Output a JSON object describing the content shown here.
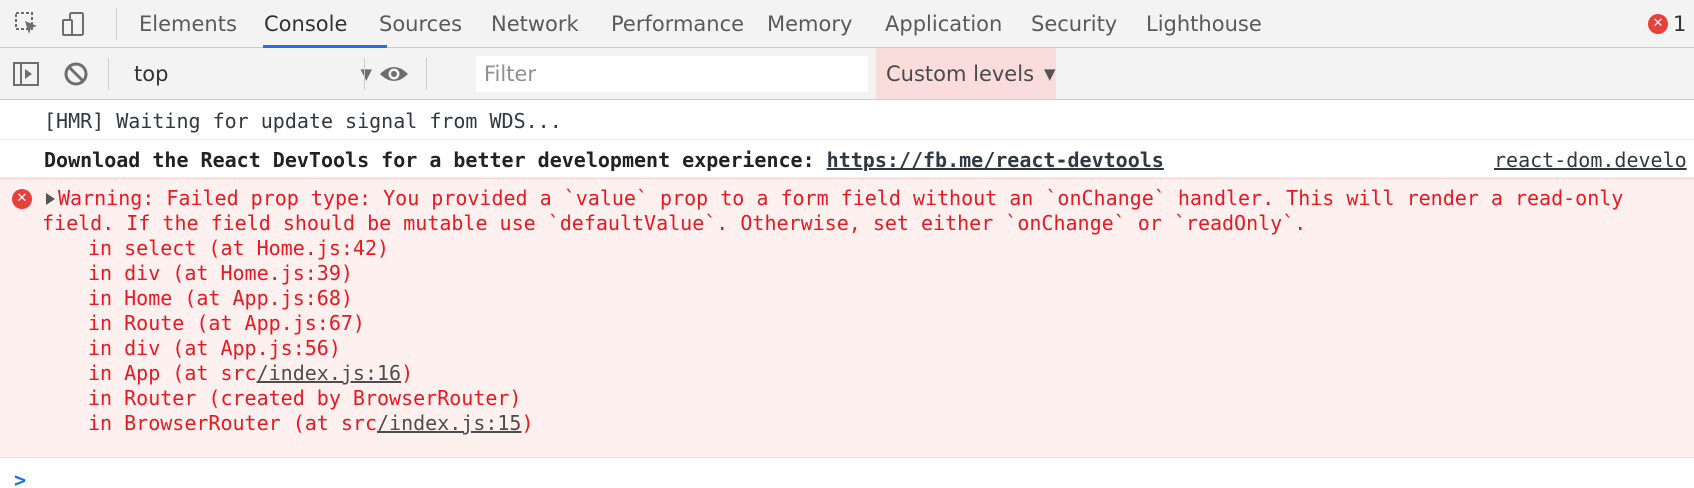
{
  "tabs": [
    {
      "label": "Elements"
    },
    {
      "label": "Console"
    },
    {
      "label": "Sources"
    },
    {
      "label": "Network"
    },
    {
      "label": "Performance"
    },
    {
      "label": "Memory"
    },
    {
      "label": "Application"
    },
    {
      "label": "Security"
    },
    {
      "label": "Lighthouse"
    }
  ],
  "active_tab": "Console",
  "error_count": "1",
  "toolbar": {
    "context": "top",
    "filter_placeholder": "Filter",
    "levels_label": "Custom levels"
  },
  "console": {
    "messages": [
      {
        "text": "[HMR] Waiting for update signal from WDS..."
      },
      {
        "text": "Download the React DevTools for a better development experience: ",
        "link": "https://fb.me/react-devtools",
        "source": "react-dom.develo"
      }
    ],
    "warning": {
      "line1": "Warning: Failed prop type: You provided a `value` prop to a form field without an `onChange` handler. This will render a read-only",
      "line2": "field. If the field should be mutable use `defaultValue`. Otherwise, set either `onChange` or `readOnly`.",
      "stack": [
        {
          "text": "in select (at Home.js:42)"
        },
        {
          "text": "in div (at Home.js:39)"
        },
        {
          "text": "in Home (at App.js:68)"
        },
        {
          "text": "in Route (at App.js:67)"
        },
        {
          "text": "in div (at App.js:56)"
        },
        {
          "pre": "in App (at src",
          "link": "/index.js:16",
          "post": ")"
        },
        {
          "text": "in Router (created by BrowserRouter)"
        },
        {
          "pre": "in BrowserRouter (at src",
          "link": "/index.js:15",
          "post": ")"
        }
      ]
    },
    "prompt": ">"
  },
  "colors": {
    "accent": "#1a73e8",
    "error": "#e8191e",
    "warning_bg": "#fff0f0"
  }
}
